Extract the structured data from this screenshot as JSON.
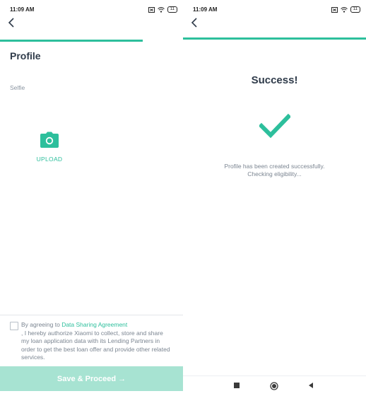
{
  "left": {
    "status": {
      "time": "11:09 AM",
      "battery": "11"
    },
    "progress_fraction": 0.78,
    "title": "Profile",
    "selfie_label": "Selfie",
    "upload_label": "UPLOAD",
    "consent": {
      "prefix": "By agreeing to ",
      "link": "Data Sharing Agreement",
      "body": ", I hereby authorize Xiaomi to collect, store and share my loan application data with its Lending Partners in order to get the best loan offer and provide other related services."
    },
    "save_button": "Save & Proceed →"
  },
  "right": {
    "status": {
      "time": "11:09 AM",
      "battery": "11"
    },
    "progress_fraction": 1.0,
    "title": "Success!",
    "line1": "Profile has been created successfully.",
    "line2": "Checking eligibility..."
  },
  "colors": {
    "accent": "#2dbf9c",
    "button_disabled": "#a7e3d2",
    "text": "#2f3b4a",
    "muted": "#7b8591"
  },
  "icons": [
    "back-icon",
    "camera-icon",
    "checkmark-icon",
    "wifi-icon",
    "battery-icon",
    "sim-icon",
    "square-nav-icon",
    "circle-nav-icon",
    "triangle-back-nav-icon"
  ]
}
